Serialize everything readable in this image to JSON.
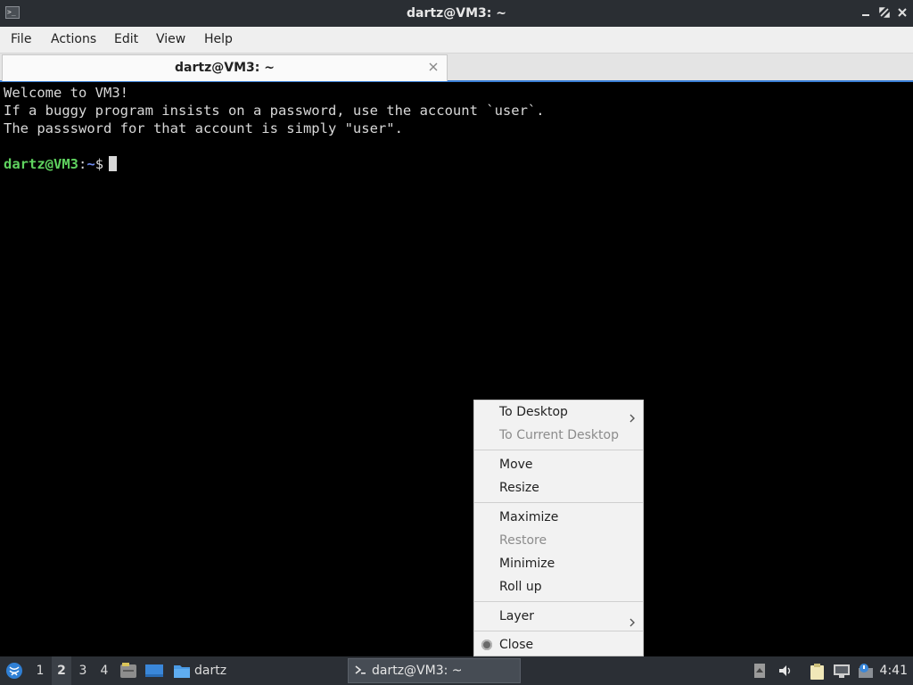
{
  "window": {
    "title": "dartz@VM3: ~",
    "controls": [
      "minimize-icon",
      "restore-icon",
      "close-icon"
    ]
  },
  "menubar": {
    "items": [
      "File",
      "Actions",
      "Edit",
      "View",
      "Help"
    ]
  },
  "tabs": [
    {
      "label": "dartz@VM3: ~",
      "active": true
    }
  ],
  "terminal": {
    "lines": [
      "Welcome to VM3!",
      "If a buggy program insists on a password, use the account `user`.",
      "The passsword for that account is simply \"user\"."
    ],
    "prompt": {
      "user_host": "dartz@VM3",
      "sep": ":",
      "path": "~",
      "symbol": "$"
    }
  },
  "context_menu": {
    "items": [
      {
        "label": "To Desktop",
        "submenu": true,
        "enabled": true
      },
      {
        "label": "To Current Desktop",
        "enabled": false
      },
      {
        "label": "Move",
        "enabled": true
      },
      {
        "label": "Resize",
        "enabled": true
      },
      {
        "label": "Maximize",
        "enabled": true
      },
      {
        "label": "Restore",
        "enabled": false
      },
      {
        "label": "Minimize",
        "enabled": true
      },
      {
        "label": "Roll up",
        "enabled": true
      },
      {
        "label": "Layer",
        "submenu": true,
        "enabled": true
      },
      {
        "label": "Close",
        "enabled": true,
        "icon": "close-dot-icon"
      }
    ]
  },
  "taskbar": {
    "workspaces": [
      "1",
      "2",
      "3",
      "4"
    ],
    "active_workspace": "2",
    "folder_label": "dartz",
    "active_task": "dartz@VM3: ~",
    "tray_icons": [
      "up-arrow-icon",
      "volume-icon",
      "clipboard-icon",
      "network-icon",
      "update-notifier-icon"
    ],
    "clock": "4:41"
  },
  "colors": {
    "titlebar": "#2a2e33",
    "terminal_bg": "#000000",
    "prompt_user": "#5fd35f",
    "prompt_path": "#6f8cf0",
    "tab_accent": "#3a7fd6",
    "taskbar": "#2b2f35"
  }
}
